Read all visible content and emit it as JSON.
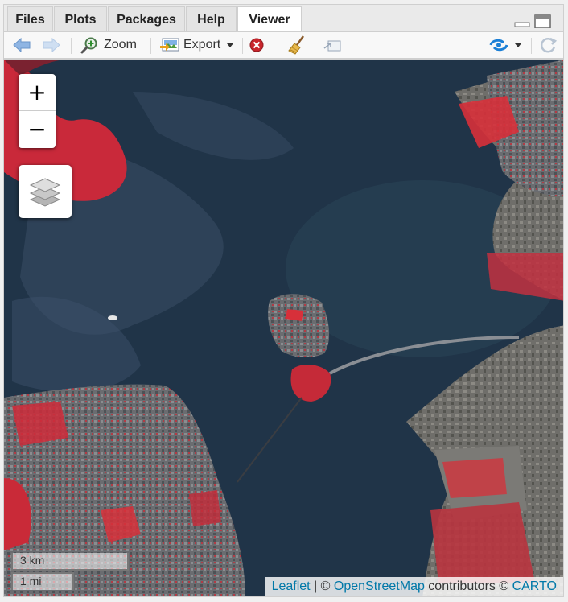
{
  "tabs": [
    {
      "label": "Files"
    },
    {
      "label": "Plots"
    },
    {
      "label": "Packages"
    },
    {
      "label": "Help"
    },
    {
      "label": "Viewer",
      "active": true
    }
  ],
  "toolbar": {
    "zoom_label": "Zoom",
    "export_label": "Export"
  },
  "map": {
    "zoom_in": "+",
    "zoom_out": "−",
    "scale_km": "3 km",
    "scale_mi": "1 mi",
    "attribution": {
      "leaflet": "Leaflet",
      "sep1": " | © ",
      "osm": "OpenStreetMap",
      "contrib": " contributors © ",
      "carto": "CARTO"
    }
  },
  "colors": {
    "water": "#1f3346",
    "vegetation": "#d7303a",
    "urban": "#6b6f72",
    "link": "#0078a8"
  },
  "icons": [
    "back-arrow-icon",
    "forward-arrow-icon",
    "zoom-icon",
    "export-icon",
    "clear-icon",
    "broom-icon",
    "popout-icon",
    "sync-icon",
    "refresh-icon",
    "layers-icon",
    "minimize-icon",
    "maximize-icon"
  ]
}
